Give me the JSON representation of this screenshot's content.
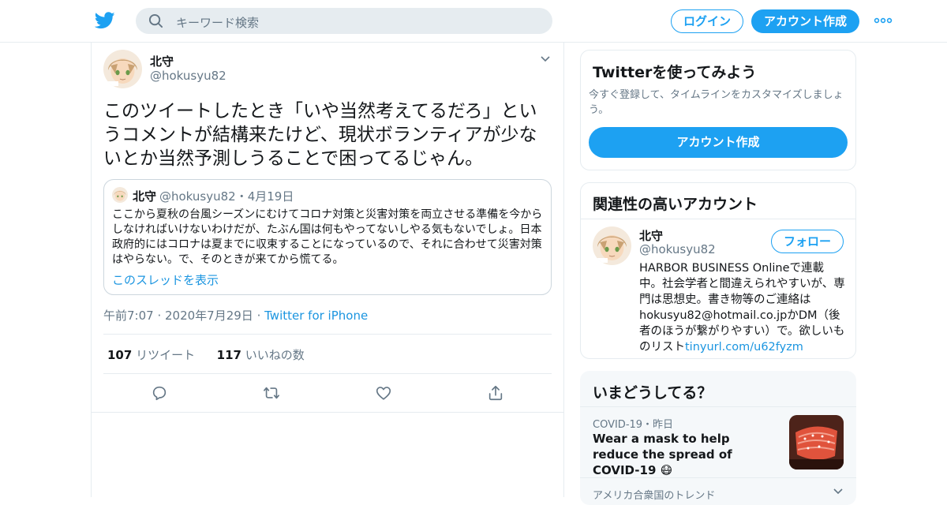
{
  "header": {
    "logo_icon": "twitter-bird-icon",
    "search_placeholder": "キーワード検索",
    "login_label": "ログイン",
    "signup_label": "アカウント作成",
    "more_icon": "more-dots-icon",
    "accent": "#1da1f2"
  },
  "tweet": {
    "author_name": "北守",
    "author_handle": "@hokusyu82",
    "text": "このツイートしたとき「いや当然考えてるだろ」というコメントが結構来たけど、現状ボランティアが少ないとか当然予測しうることで困ってるじゃん。",
    "quote": {
      "name": "北守",
      "meta": "@hokusyu82・4月19日",
      "text": "ここから夏秋の台風シーズンにむけてコロナ対策と災害対策を両立させる準備を今からしなければいけないわけだが、たぶん国は何もやってないしやる気もないでしょ。日本政府的にはコロナは夏までに収束することになっているので、それに合わせて災害対策はやらない。で、そのときが来てから慌てる。",
      "thread_link": "このスレッドを表示"
    },
    "time": "午前7:07",
    "date": "2020年7月29日",
    "via": "Twitter for iPhone",
    "retweets_count": "107",
    "retweets_label": "リツイート",
    "likes_count": "117",
    "likes_label": "いいねの数"
  },
  "sidebar": {
    "try_title": "Twitterを使ってみよう",
    "try_sub": "今すぐ登録して、タイムラインをカスタマイズしましょう。",
    "try_button": "アカウント作成",
    "related_title": "関連性の高いアカウント",
    "related": {
      "name": "北守",
      "handle": "@hokusyu82",
      "follow_label": "フォロー",
      "bio": "HARBOR BUSINESS Onlineで連載中。社会学者と間違えられやすいが、専門は思想史。書き物等のご連絡はhokusyu82@hotmail.co.jpかDM（後者のほうが繋がりやすい）で。欲しいものリスト",
      "bio_link": "tinyurl.com/u62fyzm"
    },
    "happening_title": "いまどうしてる？",
    "news_meta": "COVID-19・昨日",
    "news_title": "Wear a mask to help reduce the spread of COVID-19 😷",
    "trend_location": "アメリカ合衆国のトレンド"
  }
}
